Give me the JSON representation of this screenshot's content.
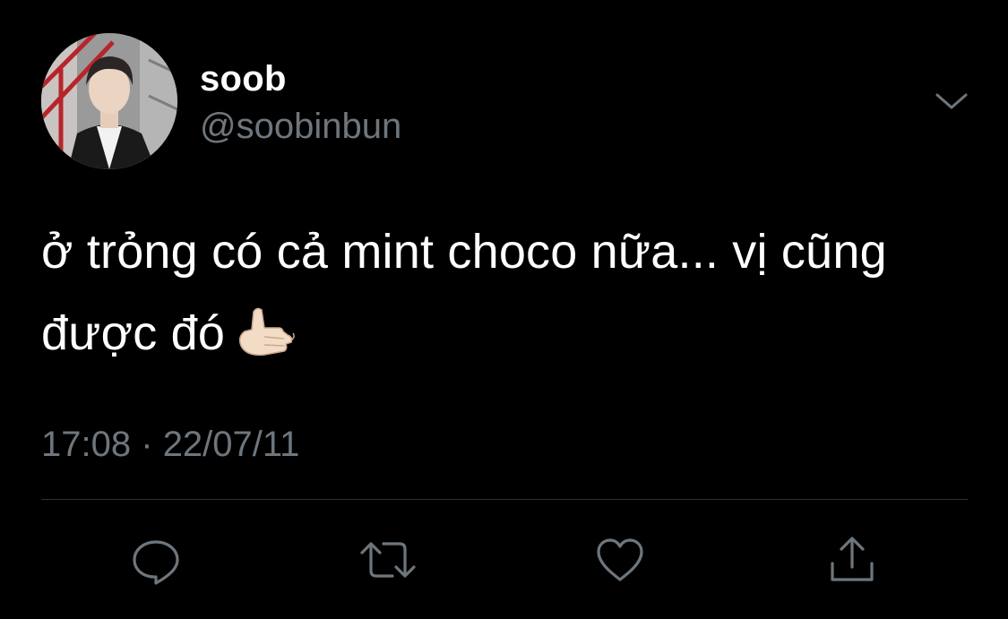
{
  "user": {
    "display_name": "soob",
    "handle": "@soobinbun",
    "avatar": "profile-photo"
  },
  "tweet": {
    "text_line1": "ở trỏng có cả mint choco nữa... vị cũng",
    "text_line2": "được đó",
    "emoji": "call-me-hand-light-skin-tone",
    "time": "17:08",
    "separator": "·",
    "date": "22/07/11"
  },
  "actions": [
    {
      "icon": "reply-icon"
    },
    {
      "icon": "retweet-icon"
    },
    {
      "icon": "like-icon"
    },
    {
      "icon": "share-icon"
    }
  ],
  "colors": {
    "background": "#000000",
    "primary_text": "#ffffff",
    "secondary_text": "#6e767d",
    "divider": "#2f3336"
  }
}
